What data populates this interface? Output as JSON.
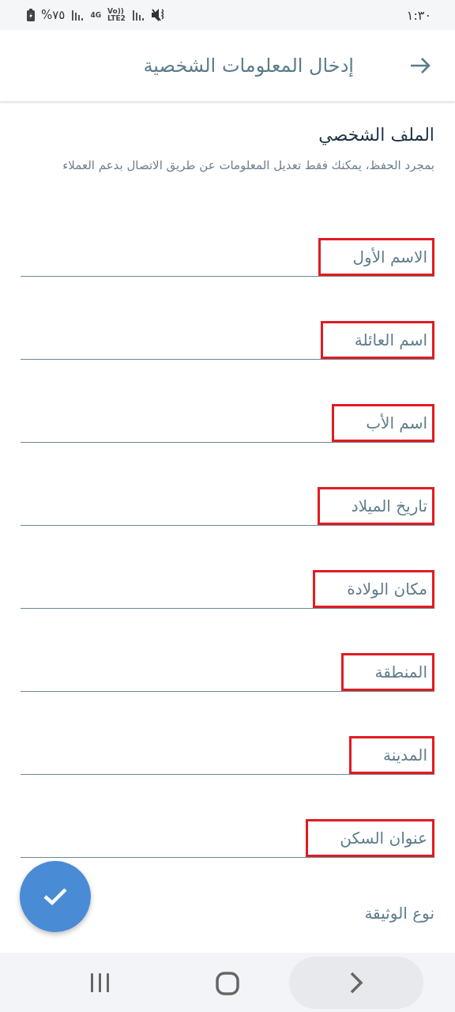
{
  "status_bar": {
    "time": "١:٣٠",
    "battery": "%٧٥",
    "network": "4G",
    "volte": "Vo))",
    "lte": "LTE2"
  },
  "header": {
    "title": "إدخال المعلومات الشخصية"
  },
  "section": {
    "title": "الملف الشخصي",
    "description": "بمجرد الحفظ، يمكنك فقط تعديل المعلومات عن طريق الاتصال بدعم العملاء"
  },
  "fields": [
    {
      "placeholder": "الاسم  الأول",
      "highlighted": true
    },
    {
      "placeholder": "اسم  العائلة",
      "highlighted": true
    },
    {
      "placeholder": "اسم  الأب",
      "highlighted": true
    },
    {
      "placeholder": "تاريخ الميلاد",
      "highlighted": true
    },
    {
      "placeholder": "مكان الولادة",
      "highlighted": true
    },
    {
      "placeholder": "المنطقة",
      "highlighted": true
    },
    {
      "placeholder": "المدينة",
      "highlighted": true
    },
    {
      "placeholder": "عنوان السكن",
      "highlighted": true
    }
  ],
  "next_label": "نوع الوثيقة"
}
